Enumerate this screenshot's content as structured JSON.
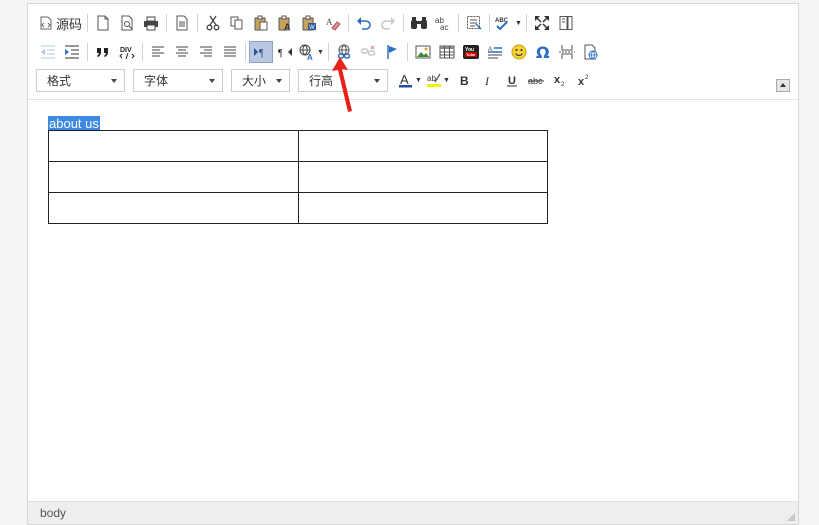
{
  "toolbar": {
    "source_label": "源码",
    "format_select": "格式",
    "font_select": "字体",
    "size_select": "大小",
    "lineheight_select": "行高"
  },
  "content": {
    "selected_text": "about us",
    "table": {
      "rows": 3,
      "cols": 2
    }
  },
  "statusbar": {
    "path": "body"
  },
  "colors": {
    "selection": "#3b8ae6",
    "annotation_arrow": "#e8201a",
    "font_color_bar": "#1f4fa8",
    "highlight_bar": "#f4f400"
  }
}
